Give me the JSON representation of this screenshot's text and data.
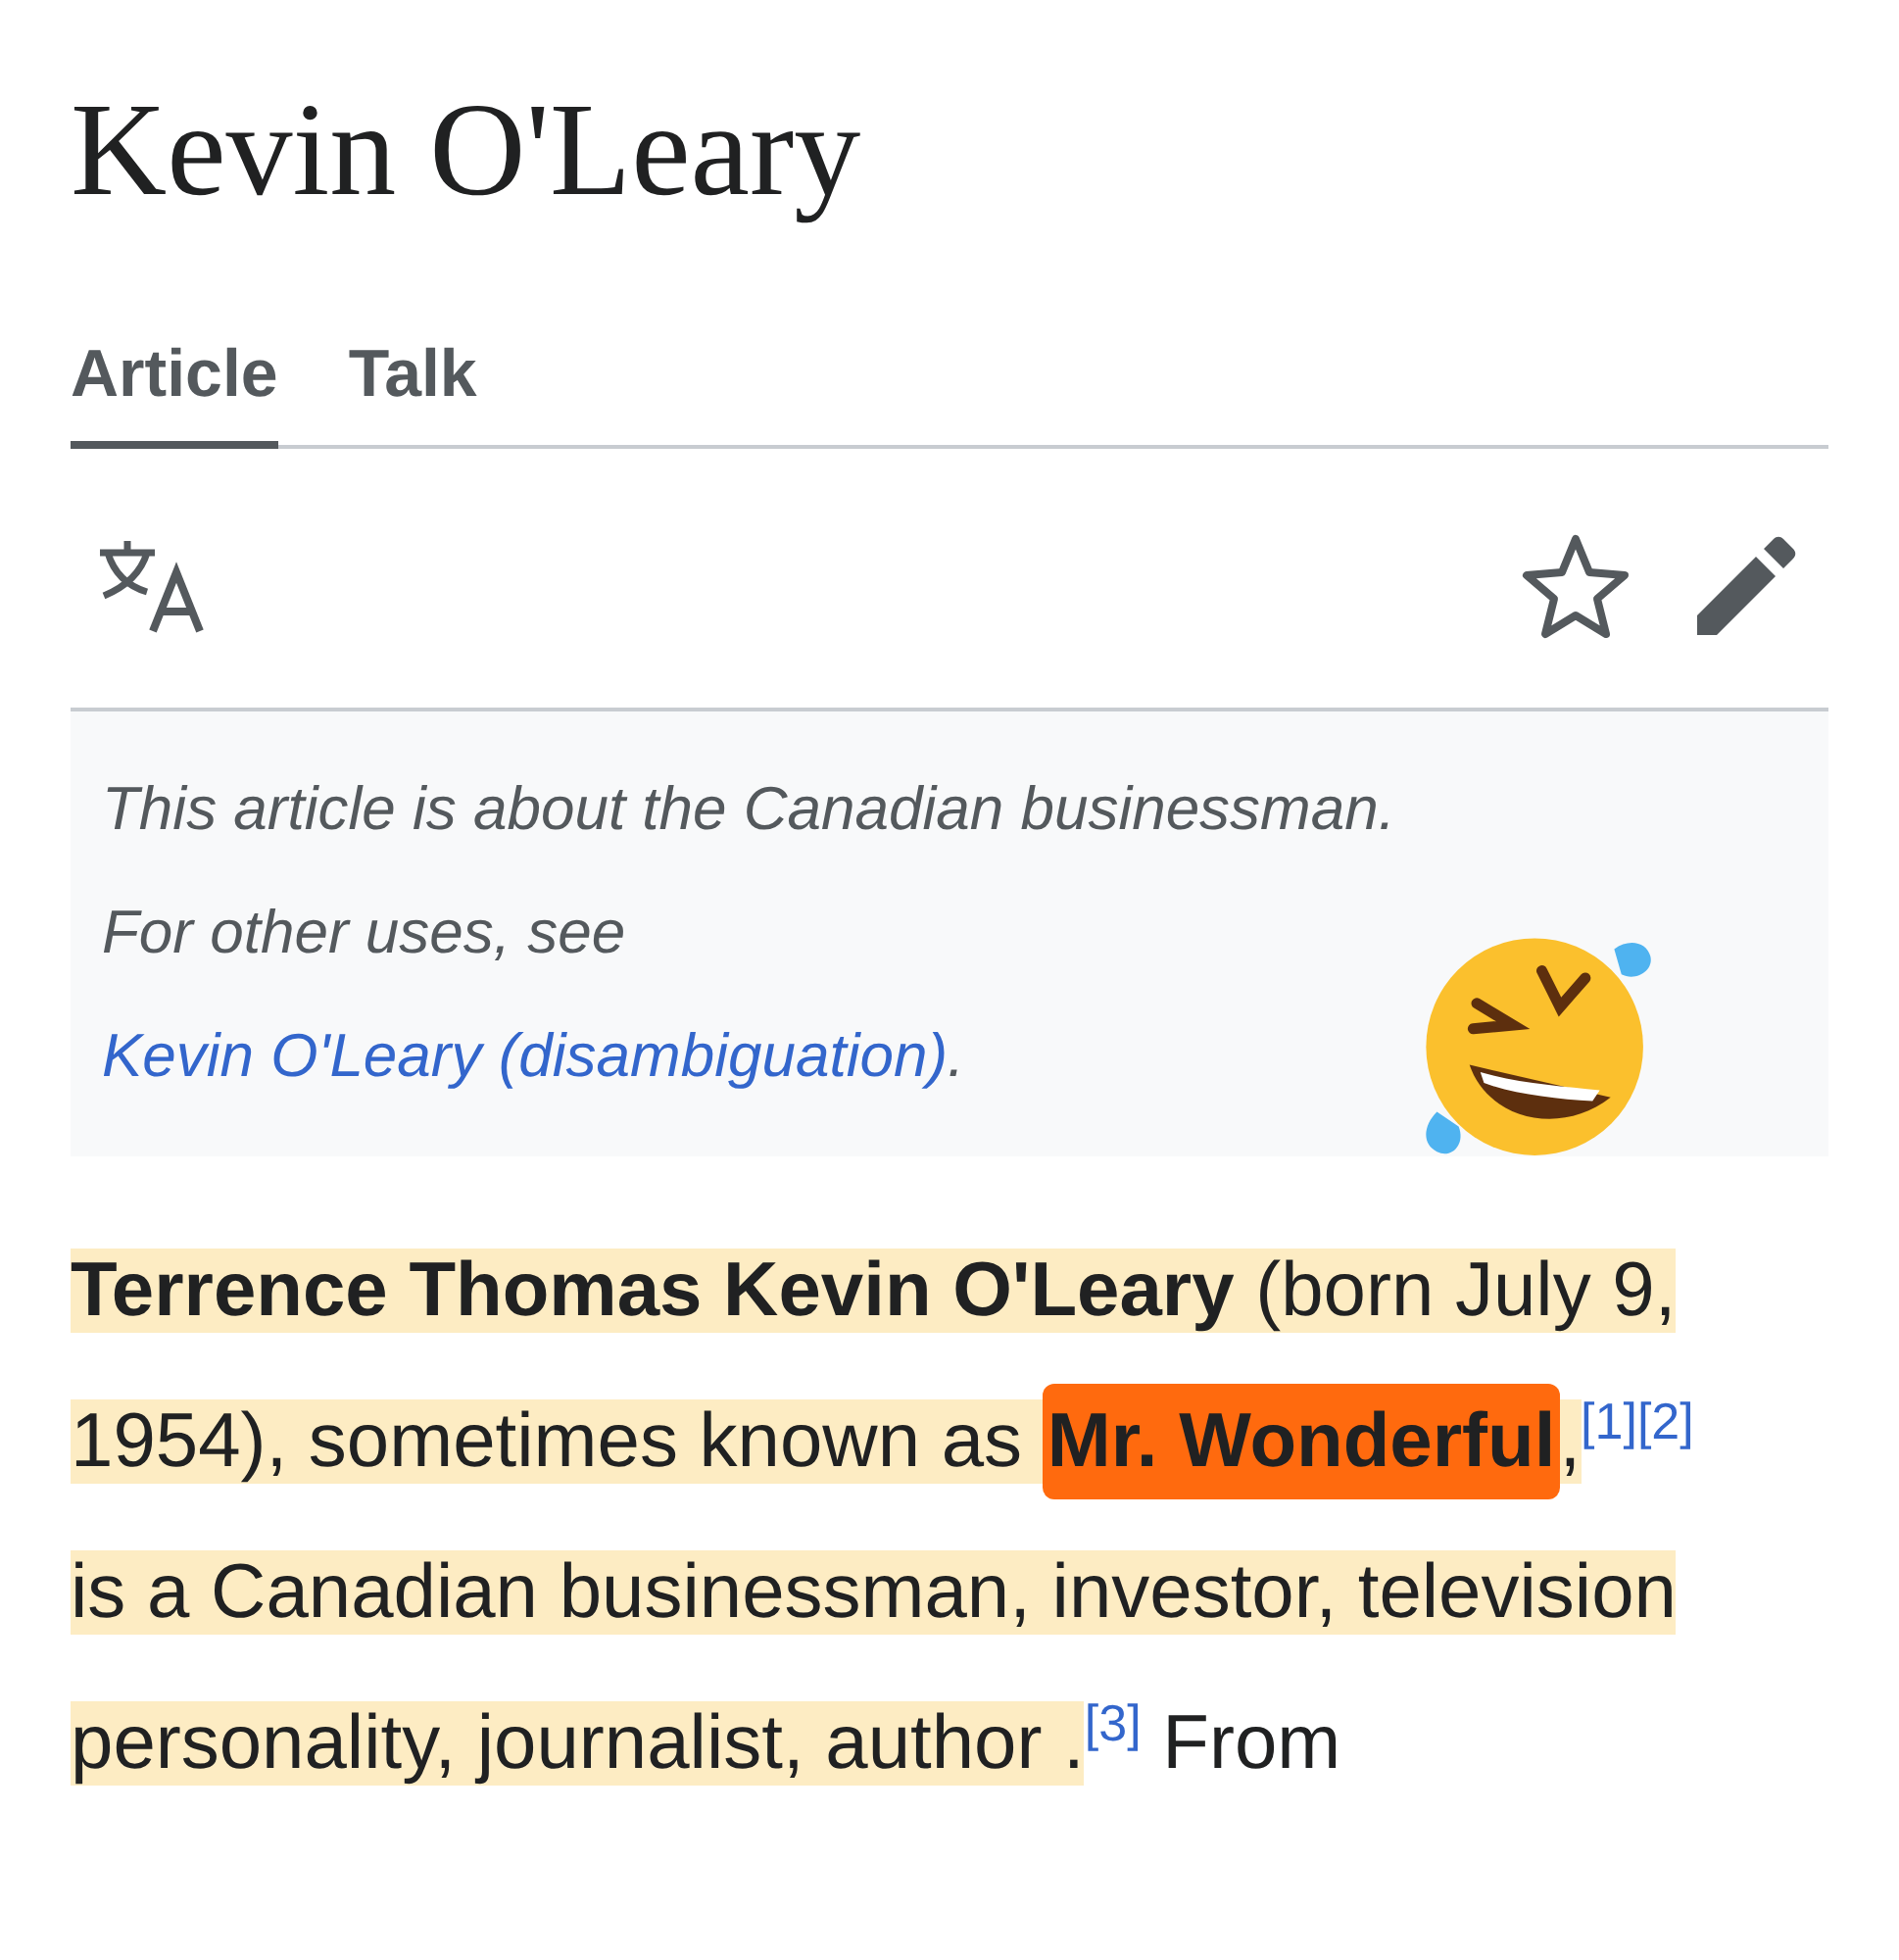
{
  "title": "Kevin O'Leary",
  "tabs": [
    {
      "label": "Article",
      "selected": true
    },
    {
      "label": "Talk",
      "selected": false
    }
  ],
  "hatnote": {
    "text": "This article is about the Canadian businessman. For other uses, see ",
    "link": "Kevin O'Leary (disambiguation)",
    "end": "."
  },
  "paragraph": [
    {
      "kind": "bold",
      "text": "Terrence Thomas Kevin O'Leary",
      "highlighted": true,
      "marker": false
    },
    {
      "kind": "text",
      "text": " (born July 9, 1954), sometimes known as ",
      "highlighted": true,
      "marker": false
    },
    {
      "kind": "bold",
      "text": "Mr. Wonderful",
      "highlighted": false,
      "marker": true
    },
    {
      "kind": "text",
      "text": ",",
      "highlighted": true,
      "marker": false
    },
    {
      "kind": "ref",
      "text": "[1]",
      "highlighted": false,
      "marker": false
    },
    {
      "kind": "ref",
      "text": "[2]",
      "highlighted": false,
      "marker": false
    },
    {
      "kind": "text",
      "text": " is a Canadian businessman, investor, television personality, journalist, author .",
      "highlighted": true,
      "marker": false
    },
    {
      "kind": "ref",
      "text": "[3]",
      "highlighted": false,
      "marker": false
    },
    {
      "kind": "text",
      "text": " From",
      "highlighted": false,
      "marker": false
    }
  ]
}
